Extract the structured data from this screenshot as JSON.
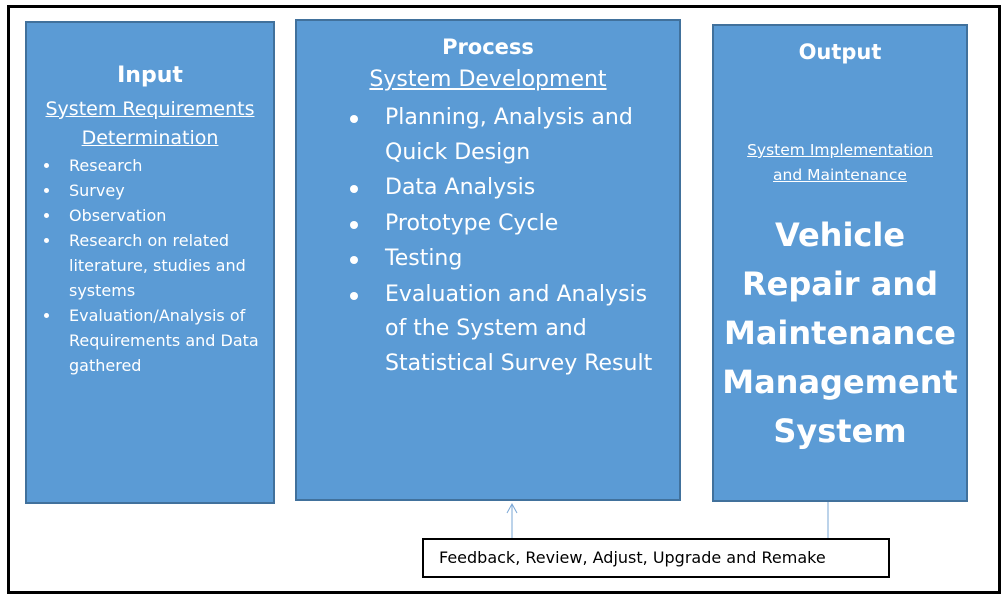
{
  "input": {
    "title": "Input",
    "subtitle_lines": [
      "System Requirements",
      "Determination"
    ],
    "items": [
      "Research",
      "Survey",
      "Observation",
      "Research on related literature, studies and systems",
      "Evaluation/Analysis of Requirements and Data gathered"
    ]
  },
  "process": {
    "title": "Process",
    "subtitle": "System Development",
    "items": [
      "Planning, Analysis and Quick Design",
      "Data Analysis",
      "Prototype Cycle",
      "Testing",
      "Evaluation and Analysis of the System and Statistical Survey Result"
    ]
  },
  "output": {
    "title": "Output",
    "subtitle_lines": [
      "System Implementation",
      "and Maintenance"
    ],
    "system_lines": [
      "Vehicle",
      "Repair and",
      "Maintenance",
      "Management",
      "System"
    ]
  },
  "feedback": {
    "label": "Feedback, Review, Adjust, Upgrade and Remake"
  },
  "colors": {
    "box_fill": "#5b9bd5",
    "box_border": "#41719c",
    "connector": "#7aa7d6"
  }
}
